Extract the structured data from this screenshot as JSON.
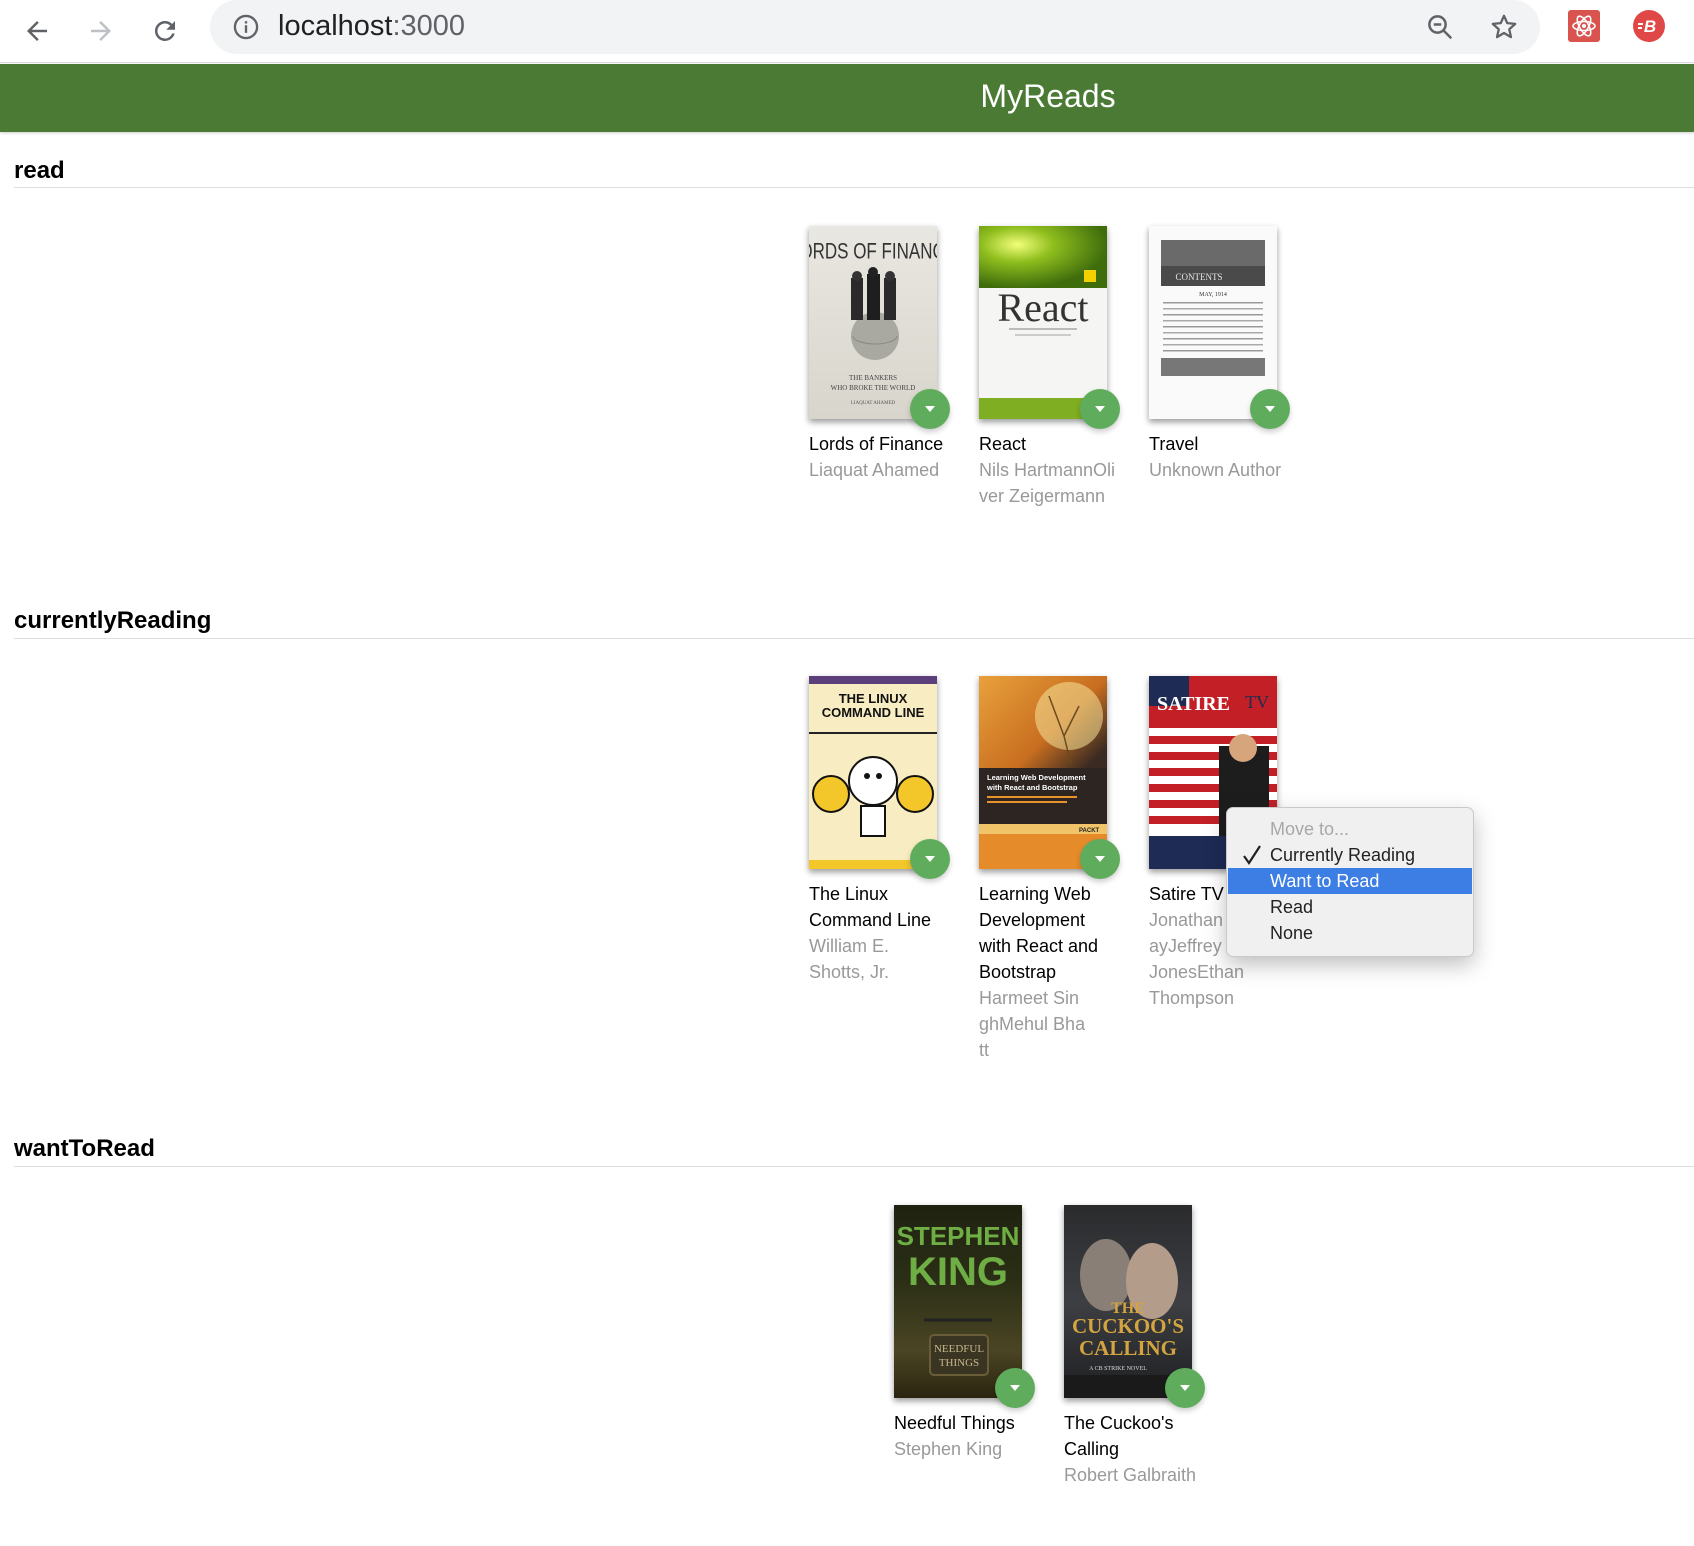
{
  "browser": {
    "url_host": "localhost",
    "url_port": ":3000",
    "icons": [
      "back-arrow-icon",
      "forward-arrow-icon",
      "reload-icon",
      "info-icon",
      "zoom-out-icon",
      "bookmark-star-icon",
      "react-devtools-extension-icon",
      "extension-b-icon"
    ]
  },
  "app": {
    "title": "MyReads",
    "header_color": "#4a7a34",
    "changer_color": "#60ac5d"
  },
  "shelves": [
    {
      "title": "read",
      "books": [
        {
          "title": "Lords of Finance",
          "authors": [
            "Liaquat Ahamed"
          ],
          "cover_text": [
            "LORDS OF FINANCE",
            "THE BANKERS",
            "WHO BROKE THE WORLD",
            "LIAQUAT AHAMED"
          ]
        },
        {
          "title": "React",
          "authors": [
            "Nils HartmannOliver Zeigermann"
          ],
          "cover_text": [
            "React"
          ]
        },
        {
          "title": "Travel",
          "authors": [
            "Unknown Author"
          ],
          "cover_text": [
            "CONTENTS",
            "MAY, 1914"
          ]
        }
      ]
    },
    {
      "title": "currentlyReading",
      "books": [
        {
          "title": "The Linux Command Line",
          "authors": [
            "William E. Shotts, Jr."
          ],
          "cover_text": [
            "THE LINUX",
            "COMMAND LINE"
          ]
        },
        {
          "title": "Learning Web Development with React and Bootstrap",
          "authors": [
            "Harmeet SinghMehul Bhatt"
          ],
          "cover_text": [
            "Learning Web Development",
            "with React and Bootstrap",
            "PACKT"
          ]
        },
        {
          "title": "Satire TV",
          "authors": [
            "Jonathan GrayJeffrey P. JonesEthan Thompson"
          ],
          "cover_text": [
            "SATIRE",
            "TV"
          ]
        }
      ]
    },
    {
      "title": "wantToRead",
      "books": [
        {
          "title": "Needful Things",
          "authors": [
            "Stephen King"
          ],
          "cover_text": [
            "STEPHEN",
            "KING",
            "NEEDFUL",
            "THINGS"
          ]
        },
        {
          "title": "The Cuckoo's Calling",
          "authors": [
            "Robert Galbraith"
          ],
          "cover_text": [
            "THE",
            "CUCKOO'S",
            "CALLING",
            "A CB STRIKE NOVEL"
          ]
        }
      ]
    }
  ],
  "move_menu": {
    "options": [
      {
        "label": "Move to...",
        "disabled": true,
        "checked": false,
        "highlighted": false
      },
      {
        "label": "Currently Reading",
        "disabled": false,
        "checked": true,
        "highlighted": false
      },
      {
        "label": "Want to Read",
        "disabled": false,
        "checked": false,
        "highlighted": true
      },
      {
        "label": "Read",
        "disabled": false,
        "checked": false,
        "highlighted": false
      },
      {
        "label": "None",
        "disabled": false,
        "checked": false,
        "highlighted": false
      }
    ]
  }
}
